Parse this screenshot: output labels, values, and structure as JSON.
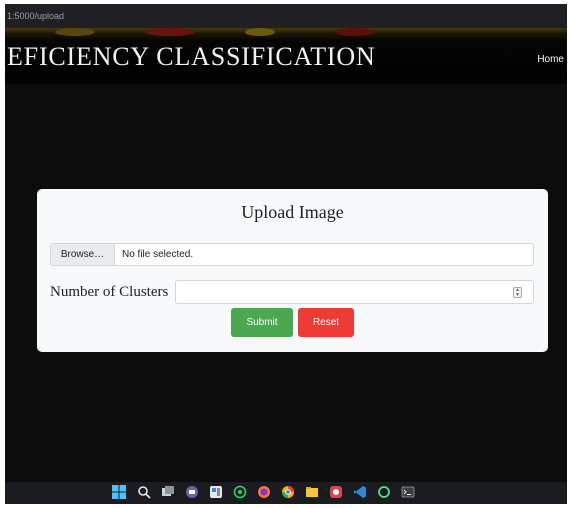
{
  "browser": {
    "url": "1:5000/upload"
  },
  "header": {
    "title": "EFICIENCY CLASSIFICATION",
    "nav_home": "Home"
  },
  "form": {
    "title": "Upload Image",
    "browse_label": "Browse…",
    "file_status": "No file selected.",
    "clusters_label": "Number of Clusters",
    "clusters_value": "",
    "submit_label": "Submit",
    "reset_label": "Reset"
  },
  "colors": {
    "page_bg": "#0c0c0c",
    "card_bg": "#f8f9fa",
    "submit": "#4aa84e",
    "reset": "#ef3b36"
  },
  "taskbar": {
    "icons": [
      "windows-start-icon",
      "search-icon",
      "task-view-icon",
      "teams-chat-icon",
      "widgets-icon",
      "whatsapp-icon",
      "firefox-icon",
      "chrome-icon",
      "file-explorer-icon",
      "app-icon",
      "vscode-icon",
      "app-icon",
      "terminal-icon"
    ]
  }
}
